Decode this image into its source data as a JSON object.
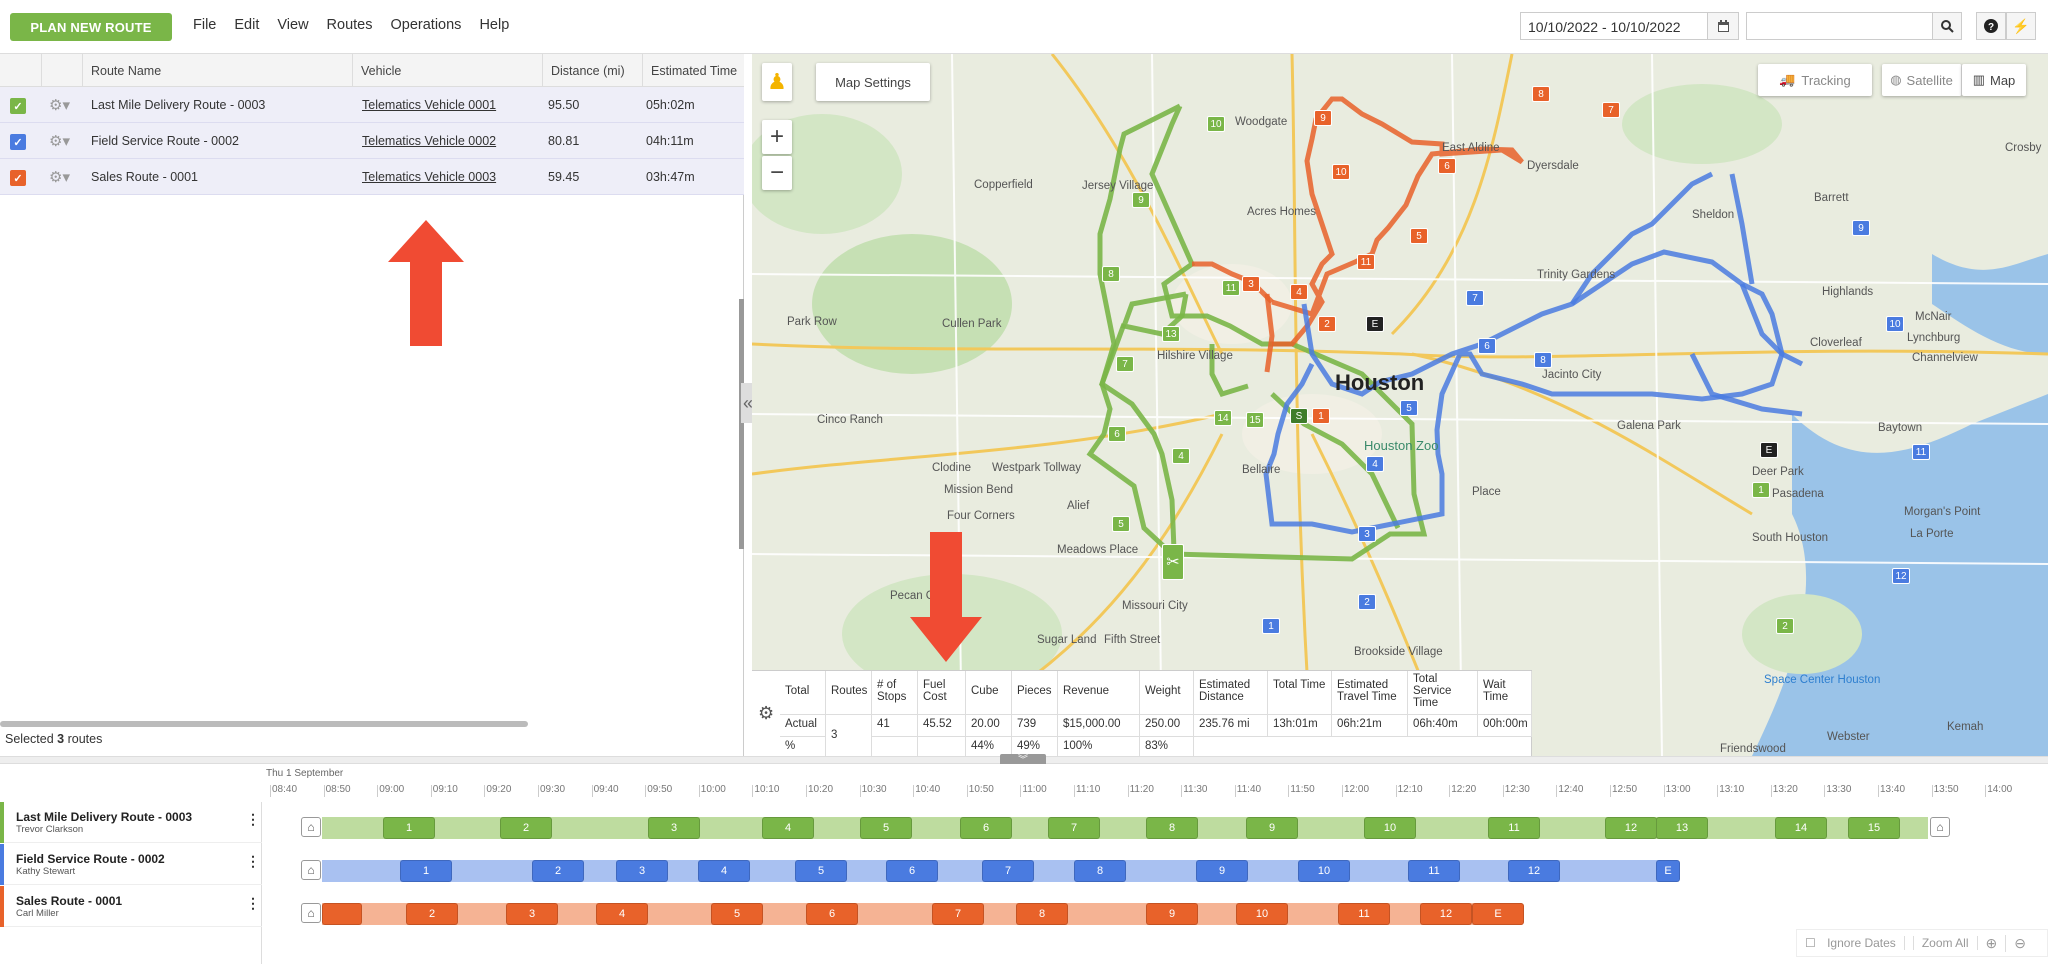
{
  "topbar": {
    "plan_button": "PLAN NEW ROUTE",
    "menu": [
      "File",
      "Edit",
      "View",
      "Routes",
      "Operations",
      "Help"
    ],
    "date_range": "10/10/2022 - 10/10/2022"
  },
  "route_table": {
    "headers": {
      "name": "Route Name",
      "vehicle": "Vehicle",
      "distance": "Distance (mi)",
      "time": "Estimated Time"
    },
    "rows": [
      {
        "name": "Last Mile Delivery Route - 0003",
        "vehicle": "Telematics Vehicle 0001",
        "distance": "95.50",
        "time": "05h:02m",
        "color": "#7ab648"
      },
      {
        "name": "Field Service Route - 0002",
        "vehicle": "Telematics Vehicle 0002",
        "distance": "80.81",
        "time": "04h:11m",
        "color": "#4a7be0"
      },
      {
        "name": "Sales Route - 0001",
        "vehicle": "Telematics Vehicle 0003",
        "distance": "59.45",
        "time": "03h:47m",
        "color": "#e8622a"
      }
    ],
    "selected_prefix": "Selected",
    "selected_count": "3",
    "selected_suffix": "routes"
  },
  "map": {
    "settings_label": "Map Settings",
    "tracking_label": "Tracking",
    "satellite_label": "Satellite",
    "map_label": "Map",
    "city_label": "Houston",
    "places": [
      "Woodgate",
      "East Aldine",
      "Dyersdale",
      "Crosby",
      "Sheldon",
      "Barrett",
      "Jersey Village",
      "Copperfield",
      "Acres Homes",
      "Trinity Gardens",
      "Highlands",
      "McNair",
      "Cloverleaf",
      "Park Row",
      "Cullen Park",
      "Jacinto City",
      "Channelview",
      "Lynchburg",
      "Hilshire Village",
      "Cinco Ranch",
      "Galena Park",
      "Baytown",
      "Deer Park",
      "Clodine",
      "Westpark Tollway",
      "Bellaire",
      "Mission Bend",
      "Pasadena",
      "Four Corners",
      "Alief",
      "Meadows Place",
      "South Houston",
      "La Porte",
      "Morgan's Point",
      "Pecan Grove",
      "Missouri City",
      "Sugar Land",
      "Fifth Street",
      "Brookside Village",
      "Space Center Houston",
      "Kemah",
      "Webster",
      "Friendswood",
      "Houston Zoo",
      "Place"
    ]
  },
  "summary": {
    "headers": [
      "Total",
      "Routes",
      "# of Stops",
      "Fuel Cost",
      "Cube",
      "Pieces",
      "Revenue",
      "Weight",
      "Estimated Distance",
      "Total Time",
      "Estimated Travel Time",
      "Total Service Time",
      "Wait Time"
    ],
    "actual": [
      "Actual",
      "3",
      "41",
      "45.52",
      "20.00",
      "739",
      "$15,000.00",
      "250.00",
      "235.76 mi",
      "13h:01m",
      "06h:21m",
      "06h:40m",
      "00h:00m"
    ],
    "percent": [
      "%",
      "",
      "",
      "",
      "44%",
      "49%",
      "100%",
      "83%",
      "",
      "",
      "",
      "",
      ""
    ]
  },
  "timeline": {
    "date_label": "Thu 1 September",
    "ticks": [
      "08:40",
      "08:50",
      "09:00",
      "09:10",
      "09:20",
      "09:30",
      "09:40",
      "09:50",
      "10:00",
      "10:10",
      "10:20",
      "10:30",
      "10:40",
      "10:50",
      "11:00",
      "11:10",
      "11:20",
      "11:30",
      "11:40",
      "11:50",
      "12:00",
      "12:10",
      "12:20",
      "12:30",
      "12:40",
      "12:50",
      "13:00",
      "13:10",
      "13:20",
      "13:30",
      "13:40",
      "13:50",
      "14:00"
    ],
    "routes": [
      {
        "name": "Last Mile Delivery Route - 0003",
        "driver": "Trevor Clarkson",
        "color": "#7ab648",
        "bg": "#bedc9f",
        "stops": [
          "1",
          "2",
          "3",
          "4",
          "5",
          "6",
          "7",
          "8",
          "9",
          "10",
          "11",
          "12",
          "13",
          "14",
          "15"
        ]
      },
      {
        "name": "Field Service Route - 0002",
        "driver": "Kathy Stewart",
        "color": "#4a7be0",
        "bg": "#a9c1f1",
        "stops": [
          "1",
          "2",
          "3",
          "4",
          "5",
          "6",
          "7",
          "8",
          "9",
          "10",
          "11",
          "12",
          "E"
        ]
      },
      {
        "name": "Sales Route - 0001",
        "driver": "Carl Miller",
        "color": "#e8622a",
        "bg": "#f5b394",
        "stops": [
          "1",
          "2",
          "3",
          "4",
          "5",
          "6",
          "7",
          "8",
          "9",
          "10",
          "11",
          "12",
          "E"
        ]
      }
    ],
    "controls": {
      "ignore_dates": "Ignore Dates",
      "zoom_all": "Zoom All"
    }
  }
}
